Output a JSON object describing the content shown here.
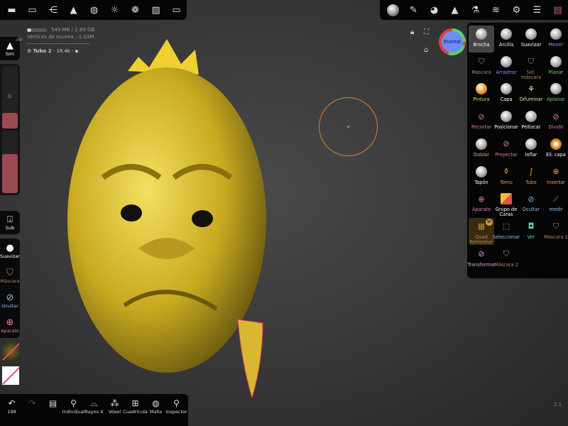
{
  "top_left_toolbar": {
    "icons": [
      "scene-icon",
      "folder-icon",
      "share-icon",
      "objects-icon",
      "mesh-icon",
      "light-icon",
      "material-icon",
      "image-icon",
      "camera-icon"
    ]
  },
  "top_right_toolbar": {
    "icons": [
      "brush-preview-icon",
      "stroke-icon",
      "palette-icon",
      "symmetry-icon",
      "flask-icon",
      "layers-icon",
      "settings-icon",
      "sliders-icon",
      "interface-icon"
    ]
  },
  "info": {
    "memory": "549 MB / 2.69 GB",
    "vertices": "Vértices de escena : 1.03M",
    "object": "Tubo 2",
    "object_count": "· 18.4k ·"
  },
  "left": {
    "sym_label": "Sim",
    "sym_badge": "l/W",
    "sub_label": "Sub",
    "tools": [
      "Suavizar",
      "Máscara",
      "Ocultar",
      "Aparato"
    ]
  },
  "gizmo": {
    "label": "Frontal"
  },
  "tools": [
    {
      "label": "Brocha",
      "color": "#ffffff",
      "icon": "sphere"
    },
    {
      "label": "Arcilla",
      "color": "#ffffff",
      "icon": "sphere"
    },
    {
      "label": "Suavizar",
      "color": "#ffffff",
      "icon": "sphere"
    },
    {
      "label": "Mover",
      "color": "#9a8cff",
      "icon": "sphere"
    },
    {
      "label": "Máscara",
      "color": "#b08a70",
      "icon": "shield"
    },
    {
      "label": "Arrastrar",
      "color": "#9a8cff",
      "icon": "sphere"
    },
    {
      "label": "Sel. máscara",
      "color": "#b08a70",
      "icon": "shield"
    },
    {
      "label": "Planar",
      "color": "#7fd070",
      "icon": "sphere"
    },
    {
      "label": "Pintura",
      "color": "#d8d870",
      "icon": "paint"
    },
    {
      "label": "Capa",
      "color": "#ffffff",
      "icon": "sphere"
    },
    {
      "label": "Difuminar",
      "color": "#f0e8a0",
      "icon": "smudge"
    },
    {
      "label": "Aplanar",
      "color": "#7fd070",
      "icon": "sphere"
    },
    {
      "label": "Recortar",
      "color": "#e08080",
      "icon": "cut"
    },
    {
      "label": "Posicionar",
      "color": "#ffffff",
      "icon": "sphere"
    },
    {
      "label": "Pellizcar",
      "color": "#ffffff",
      "icon": "sphere"
    },
    {
      "label": "Dividir",
      "color": "#e08080",
      "icon": "cut"
    },
    {
      "label": "Doblar",
      "color": "#e0a080",
      "icon": "sphere"
    },
    {
      "label": "Proyectar",
      "color": "#e080a0",
      "icon": "cut"
    },
    {
      "label": "Inflar",
      "color": "#ffffff",
      "icon": "sphere"
    },
    {
      "label": "Eli. capa",
      "color": "#ffffff",
      "icon": "orange"
    },
    {
      "label": "Tapón",
      "color": "#ffffff",
      "icon": "sphere"
    },
    {
      "label": "Torno",
      "color": "#f0a030",
      "icon": "vase"
    },
    {
      "label": "Tubo",
      "color": "#f0a030",
      "icon": "tube"
    },
    {
      "label": "Insertar",
      "color": "#f0a030",
      "icon": "insert"
    },
    {
      "label": "Aparato",
      "color": "#e080b0",
      "icon": "gizmo"
    },
    {
      "label": "Grupo de Caras",
      "color": "#ffffff",
      "icon": "facegroup"
    },
    {
      "label": "Ocultar",
      "color": "#8cc0f0",
      "icon": "hide"
    },
    {
      "label": "medir",
      "color": "#8cc0f0",
      "icon": "ruler"
    },
    {
      "label": "Quad Remesher",
      "color": "#b08a50",
      "icon": "grid"
    },
    {
      "label": "Seleccionar",
      "color": "#8cc0f0",
      "icon": "select"
    },
    {
      "label": "Ver",
      "color": "#60d0a0",
      "icon": "camera"
    },
    {
      "label": "Máscara 1",
      "color": "#b08a70",
      "icon": "shield"
    },
    {
      "label": "Transformar",
      "color": "#e0a0e0",
      "icon": "transform"
    },
    {
      "label": "Máscara 2",
      "color": "#b08a70",
      "icon": "shield"
    }
  ],
  "quad_badge": "W",
  "bottom": {
    "undo_count": "198",
    "items": [
      "Individual",
      "Rayos X",
      "Vóxel",
      "Cuadrícula",
      "Malla",
      "Inspector"
    ]
  },
  "version": "2.1"
}
